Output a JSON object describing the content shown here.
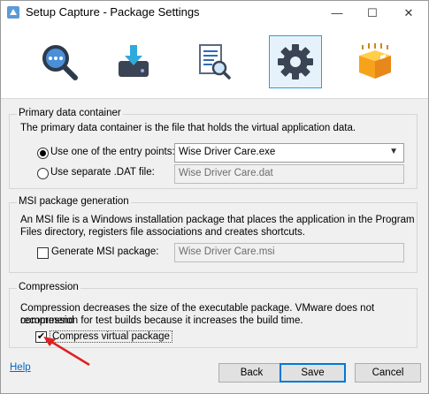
{
  "window": {
    "title": "Setup Capture - Package Settings",
    "controls": {
      "minimize": "—",
      "maximize": "☐",
      "close": "✕"
    }
  },
  "toolbar": {
    "icons": [
      "magnifier-icon",
      "download-disk-icon",
      "document-search-icon",
      "gear-icon",
      "package-box-icon"
    ],
    "active": "gear-icon"
  },
  "primary": {
    "legend": "Primary data container",
    "description": "The primary data container is the file that holds the virtual application data.",
    "option_entry_label": "Use one of the entry points:",
    "option_entry_selected": true,
    "entry_point_value": "Wise Driver Care.exe",
    "option_dat_label": "Use separate .DAT file:",
    "dat_value": "Wise Driver Care.dat"
  },
  "msi": {
    "legend": "MSI package generation",
    "description_line1": "An MSI file is a Windows installation package that places the application in the Program",
    "description_line2": "Files directory, registers file associations and creates shortcuts.",
    "generate_label": "Generate MSI package:",
    "generate_checked": false,
    "msi_value": "Wise Driver Care.msi"
  },
  "compression": {
    "legend": "Compression",
    "description_line1": "Compression decreases the size of the executable package. VMware does not recommend",
    "description_line2": "compression for test builds because it increases the build time.",
    "compress_label": "Compress virtual package",
    "compress_checked": true,
    "check_mark": "✔"
  },
  "footer": {
    "help": "Help",
    "back": "Back",
    "save": "Save",
    "cancel": "Cancel"
  },
  "colors": {
    "accent": "#0078d7",
    "annotation_arrow": "#e02020",
    "active_tool_border": "#26a0da"
  }
}
